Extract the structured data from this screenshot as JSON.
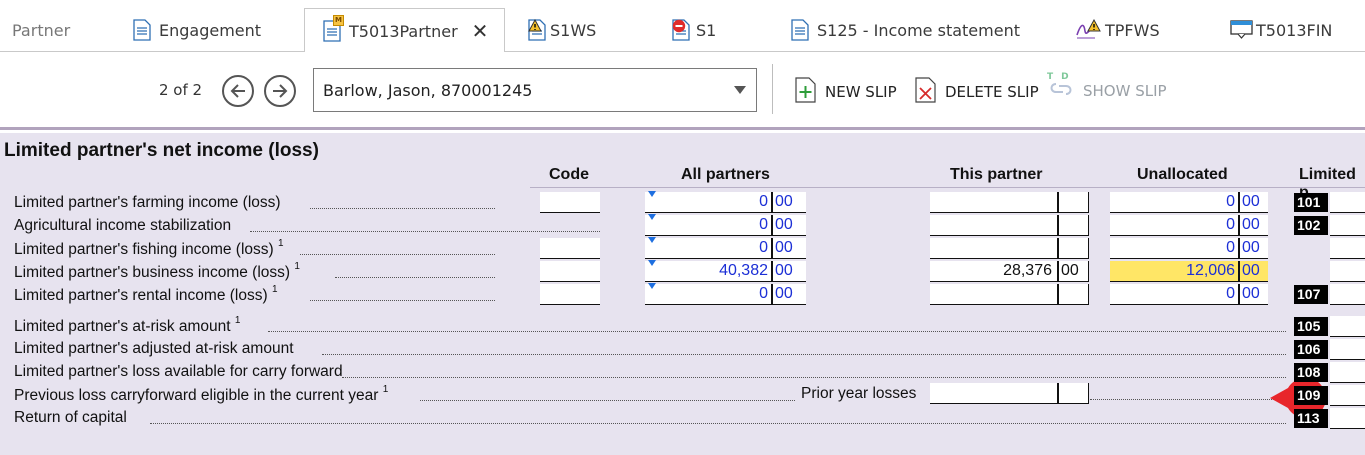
{
  "tabs": [
    {
      "label": "Partner",
      "icon": "document-icon"
    },
    {
      "label": "Engagement",
      "icon": "document-icon"
    },
    {
      "label": "T5013Partner",
      "icon": "document-modified-icon",
      "active": true
    },
    {
      "label": "S1WS",
      "icon": "document-warning-icon"
    },
    {
      "label": "S1",
      "icon": "document-error-icon"
    },
    {
      "label": "S125 - Income statement",
      "icon": "document-icon"
    },
    {
      "label": "TPFWS",
      "icon": "signature-warning-icon"
    },
    {
      "label": "T5013FIN",
      "icon": "form-icon"
    }
  ],
  "toolbar": {
    "page_count": "2 of 2",
    "slip_selector": "Barlow, Jason, 870001245",
    "new_slip": "NEW SLIP",
    "delete_slip": "DELETE SLIP",
    "show_slip": "SHOW SLIP",
    "show_slip_icon_letters": "TD"
  },
  "section": {
    "title": "Limited partner's net income (loss)",
    "columns": {
      "code": "Code",
      "all_partners": "All partners",
      "this_partner": "This partner",
      "unallocated": "Unallocated",
      "limited": "Limited p"
    },
    "income_rows": [
      {
        "label": "Limited partner's farming income (loss)",
        "footnote": "",
        "all_whole": "0",
        "all_cents": "00",
        "this_whole": "",
        "this_cents": "",
        "un_whole": "0",
        "un_cents": "00",
        "box": "101"
      },
      {
        "label": "Agricultural income stabilization",
        "footnote": "",
        "all_whole": "0",
        "all_cents": "00",
        "this_whole": "",
        "this_cents": "",
        "un_whole": "0",
        "un_cents": "00",
        "box": "102"
      },
      {
        "label": "Limited partner's fishing income (loss)",
        "footnote": "1",
        "all_whole": "0",
        "all_cents": "00",
        "this_whole": "",
        "this_cents": "",
        "un_whole": "0",
        "un_cents": "00",
        "box": ""
      },
      {
        "label": "Limited partner's business income (loss)",
        "footnote": "1",
        "all_whole": "40,382",
        "all_cents": "00",
        "this_whole": "28,376",
        "this_cents": "00",
        "un_whole": "12,006",
        "un_cents": "00",
        "box": ""
      },
      {
        "label": "Limited partner's rental income (loss)",
        "footnote": "1",
        "all_whole": "0",
        "all_cents": "00",
        "this_whole": "",
        "this_cents": "",
        "un_whole": "0",
        "un_cents": "00",
        "box": "107"
      }
    ],
    "other_rows": [
      {
        "label": "Limited partner's at-risk amount",
        "footnote": "1",
        "box": "105"
      },
      {
        "label": "Limited partner's adjusted at-risk amount",
        "footnote": "",
        "box": "106"
      },
      {
        "label": "Limited partner's loss available for carry forward",
        "footnote": "",
        "box": "108"
      },
      {
        "label": "Previous loss carryforward eligible in the current year",
        "footnote": "1",
        "box": "109"
      },
      {
        "label": "Return of capital",
        "footnote": "",
        "box": "113"
      }
    ],
    "prior_year_label": "Prior year losses",
    "callout_number": "4",
    "colors": {
      "highlight": "#ffe666",
      "callout": "#e8262b",
      "value_blue": "#1c2fd6",
      "form_bg": "#e7e3ef"
    }
  }
}
